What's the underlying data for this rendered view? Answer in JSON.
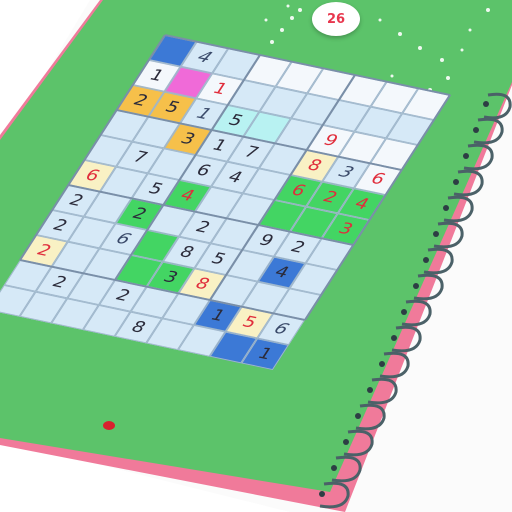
{
  "level": {
    "number": "26"
  },
  "colors": {
    "notebook_green": "#5cc36a",
    "cell_default": "#d6e9f7",
    "cell_white": "#f4f8fc",
    "cell_yellow": "#f9f1c4",
    "cell_orange": "#f6c04a",
    "cell_blue": "#3c79d6",
    "cell_green": "#43d563",
    "cell_pink": "#f06ad8",
    "cell_cyan": "#b8f2f2",
    "digit_dark": "#2b2b3a",
    "digit_red": "#e02e3c",
    "spiral": "#4b6168",
    "page_edge": "#f07a9a"
  },
  "board": {
    "cells": [
      {
        "v": "",
        "c": "blue"
      },
      {
        "v": "4",
        "c": "default",
        "t": "hand"
      },
      {
        "v": "",
        "c": "default"
      },
      {
        "v": "",
        "c": "white"
      },
      {
        "v": "",
        "c": "white"
      },
      {
        "v": "",
        "c": "white"
      },
      {
        "v": "",
        "c": "white"
      },
      {
        "v": "",
        "c": "white"
      },
      {
        "v": "",
        "c": "white"
      },
      {
        "v": "1",
        "c": "white"
      },
      {
        "v": "",
        "c": "pink"
      },
      {
        "v": "1",
        "c": "white",
        "t": "red"
      },
      {
        "v": "",
        "c": "default"
      },
      {
        "v": "",
        "c": "default"
      },
      {
        "v": "",
        "c": "default"
      },
      {
        "v": "",
        "c": "default"
      },
      {
        "v": "",
        "c": "default"
      },
      {
        "v": "",
        "c": "default"
      },
      {
        "v": "2",
        "c": "orange"
      },
      {
        "v": "5",
        "c": "orange"
      },
      {
        "v": "1",
        "c": "default",
        "t": "hand"
      },
      {
        "v": "5",
        "c": "cyan"
      },
      {
        "v": "",
        "c": "cyan"
      },
      {
        "v": "",
        "c": "default"
      },
      {
        "v": "9",
        "c": "white",
        "t": "red"
      },
      {
        "v": "",
        "c": "white"
      },
      {
        "v": "",
        "c": "white"
      },
      {
        "v": "",
        "c": "default"
      },
      {
        "v": "",
        "c": "default"
      },
      {
        "v": "3",
        "c": "orange"
      },
      {
        "v": "1",
        "c": "default"
      },
      {
        "v": "7",
        "c": "default"
      },
      {
        "v": "",
        "c": "default"
      },
      {
        "v": "8",
        "c": "yellow",
        "t": "red"
      },
      {
        "v": "3",
        "c": "default",
        "t": "hand"
      },
      {
        "v": "6",
        "c": "white",
        "t": "red"
      },
      {
        "v": "",
        "c": "default"
      },
      {
        "v": "7",
        "c": "default"
      },
      {
        "v": "",
        "c": "default"
      },
      {
        "v": "6",
        "c": "default"
      },
      {
        "v": "4",
        "c": "default"
      },
      {
        "v": "",
        "c": "default"
      },
      {
        "v": "6",
        "c": "green",
        "t": "red"
      },
      {
        "v": "2",
        "c": "green",
        "t": "red"
      },
      {
        "v": "4",
        "c": "green",
        "t": "red"
      },
      {
        "v": "6",
        "c": "yellow",
        "t": "red"
      },
      {
        "v": "",
        "c": "default"
      },
      {
        "v": "5",
        "c": "default"
      },
      {
        "v": "4",
        "c": "green",
        "t": "red"
      },
      {
        "v": "",
        "c": "default"
      },
      {
        "v": "",
        "c": "default"
      },
      {
        "v": "",
        "c": "green"
      },
      {
        "v": "",
        "c": "green"
      },
      {
        "v": "3",
        "c": "green",
        "t": "red"
      },
      {
        "v": "2",
        "c": "default"
      },
      {
        "v": "",
        "c": "default"
      },
      {
        "v": "2",
        "c": "green"
      },
      {
        "v": "",
        "c": "default"
      },
      {
        "v": "2",
        "c": "default"
      },
      {
        "v": "",
        "c": "default"
      },
      {
        "v": "9",
        "c": "default"
      },
      {
        "v": "2",
        "c": "default"
      },
      {
        "v": "",
        "c": "default"
      },
      {
        "v": "2",
        "c": "default"
      },
      {
        "v": "",
        "c": "default"
      },
      {
        "v": "6",
        "c": "default",
        "t": "hand"
      },
      {
        "v": "",
        "c": "green"
      },
      {
        "v": "8",
        "c": "default"
      },
      {
        "v": "5",
        "c": "default"
      },
      {
        "v": "",
        "c": "default"
      },
      {
        "v": "4",
        "c": "blue"
      },
      {
        "v": "",
        "c": "default"
      },
      {
        "v": "2",
        "c": "yellow",
        "t": "red"
      },
      {
        "v": "",
        "c": "default"
      },
      {
        "v": "",
        "c": "default"
      },
      {
        "v": "",
        "c": "green"
      },
      {
        "v": "3",
        "c": "green"
      },
      {
        "v": "8",
        "c": "yellow",
        "t": "red"
      },
      {
        "v": "",
        "c": "default"
      },
      {
        "v": "",
        "c": "default"
      },
      {
        "v": "",
        "c": "default"
      }
    ],
    "lower": [
      {
        "v": "",
        "c": "default"
      },
      {
        "v": "2",
        "c": "default"
      },
      {
        "v": "",
        "c": "default"
      },
      {
        "v": "2",
        "c": "default"
      },
      {
        "v": "",
        "c": "default"
      },
      {
        "v": "",
        "c": "default"
      },
      {
        "v": "1",
        "c": "blue"
      },
      {
        "v": "5",
        "c": "yellow",
        "t": "red"
      },
      {
        "v": "6",
        "c": "default",
        "t": "hand"
      },
      {
        "v": "",
        "c": "default"
      },
      {
        "v": "",
        "c": "default"
      },
      {
        "v": "",
        "c": "default"
      },
      {
        "v": "",
        "c": "default"
      },
      {
        "v": "8",
        "c": "default"
      },
      {
        "v": "",
        "c": "default"
      },
      {
        "v": "",
        "c": "default"
      },
      {
        "v": "",
        "c": "blue"
      },
      {
        "v": "1",
        "c": "blue"
      }
    ]
  }
}
